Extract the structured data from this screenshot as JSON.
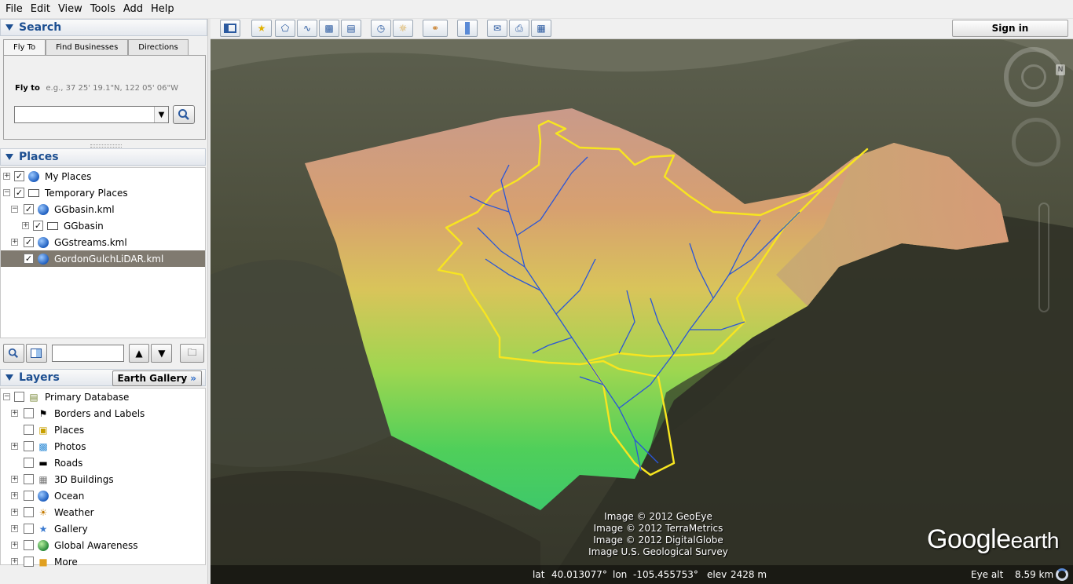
{
  "menu": [
    "File",
    "Edit",
    "View",
    "Tools",
    "Add",
    "Help"
  ],
  "search": {
    "title": "Search",
    "tabs": [
      "Fly To",
      "Find Businesses",
      "Directions"
    ],
    "fly_label": "Fly to",
    "fly_hint": "e.g., 37 25' 19.1\"N, 122 05' 06\"W",
    "fly_value": ""
  },
  "places": {
    "title": "Places",
    "items": [
      {
        "label": "My Places",
        "checked": true
      },
      {
        "label": "Temporary Places",
        "checked": true
      },
      {
        "label": "GGbasin.kml",
        "checked": true
      },
      {
        "label": "GGbasin",
        "checked": true
      },
      {
        "label": "GGstreams.kml",
        "checked": true
      },
      {
        "label": "GordonGulchLiDAR.kml",
        "checked": true,
        "selected": true
      }
    ]
  },
  "layers": {
    "title": "Layers",
    "gallery_button": "Earth Gallery",
    "items": [
      {
        "label": "Primary Database",
        "checked": false
      },
      {
        "label": "Borders and Labels",
        "checked": false
      },
      {
        "label": "Places",
        "checked": false
      },
      {
        "label": "Photos",
        "checked": false
      },
      {
        "label": "Roads",
        "checked": false
      },
      {
        "label": "3D Buildings",
        "checked": false
      },
      {
        "label": "Ocean",
        "checked": false
      },
      {
        "label": "Weather",
        "checked": false
      },
      {
        "label": "Gallery",
        "checked": false
      },
      {
        "label": "Global Awareness",
        "checked": false
      },
      {
        "label": "More",
        "checked": false
      }
    ]
  },
  "toolbar": {
    "sign_in": "Sign in"
  },
  "viewport": {
    "attribution": [
      "Image © 2012 GeoEye",
      "Image © 2012 TerraMetrics",
      "Image © 2012 DigitalGlobe",
      "Image U.S. Geological Survey"
    ],
    "logo_google": "Google",
    "logo_earth": "earth",
    "status": {
      "lat_label": "lat",
      "lat": "40.013077°",
      "lon_label": "lon",
      "lon": "-105.455753°",
      "elev_label": "elev",
      "elev": "2428 m",
      "eye_alt_label": "Eye alt",
      "eye_alt": "8.59 km"
    }
  }
}
